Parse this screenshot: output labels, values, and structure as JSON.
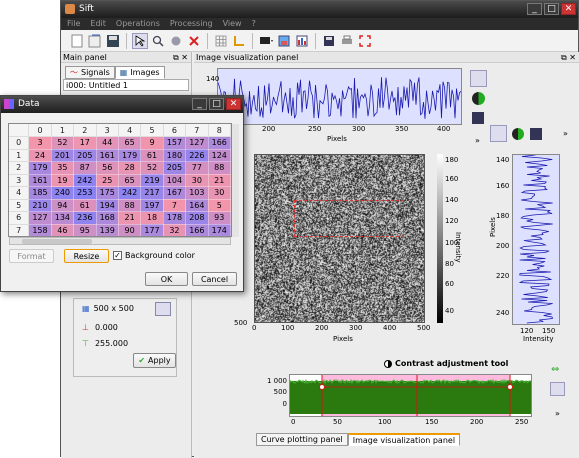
{
  "main": {
    "title": "Sift",
    "menu": [
      "File",
      "Edit",
      "Operations",
      "Processing",
      "View",
      "?"
    ]
  },
  "left_panel": {
    "title": "Main panel",
    "tabs": [
      "Signals",
      "Images"
    ],
    "item": "i000: Untitled 1",
    "size": "500 x 500",
    "min": "0.000",
    "max": "255.000",
    "apply": "Apply"
  },
  "image_panel": {
    "title": "Image visualization panel",
    "top_xlabel": "Pixels",
    "top_xticks": [
      "150",
      "200",
      "250",
      "300",
      "350",
      "400"
    ],
    "main_xlabel": "Pixels",
    "main_xticks": [
      "0",
      "100",
      "200",
      "300",
      "400",
      "500"
    ],
    "main_yticks": [
      "500"
    ],
    "colorbar_label": "Intensity",
    "colorbar_ticks": [
      "180",
      "160",
      "140",
      "120",
      "100",
      "80",
      "60",
      "40"
    ],
    "side_yticks": [
      "140",
      "160",
      "180",
      "200",
      "220",
      "240"
    ],
    "side_ylabel": "Pixels",
    "side_xticks": [
      "120",
      "150"
    ],
    "side_xlabel": "Intensity",
    "top_yticks": [
      "140"
    ],
    "contrast_title": "Contrast adjustment tool",
    "contrast_yticks": [
      "1 000",
      "500",
      "0"
    ],
    "contrast_xticks": [
      "0",
      "50",
      "100",
      "150",
      "200",
      "250"
    ],
    "bottom_tabs": [
      "Curve plotting panel",
      "Image visualization panel"
    ]
  },
  "dialog": {
    "title": "Data",
    "col_headers": [
      "0",
      "1",
      "2",
      "3",
      "4",
      "5",
      "6",
      "7",
      "8"
    ],
    "rows": [
      {
        "h": "0",
        "v": [
          "3",
          "52",
          "17",
          "44",
          "65",
          "9",
          "157",
          "127",
          "166"
        ]
      },
      {
        "h": "1",
        "v": [
          "24",
          "201",
          "205",
          "161",
          "179",
          "61",
          "180",
          "226",
          "124"
        ]
      },
      {
        "h": "2",
        "v": [
          "179",
          "35",
          "87",
          "56",
          "28",
          "52",
          "205",
          "77",
          "88"
        ]
      },
      {
        "h": "3",
        "v": [
          "161",
          "19",
          "242",
          "25",
          "65",
          "219",
          "104",
          "30",
          "21"
        ]
      },
      {
        "h": "4",
        "v": [
          "185",
          "240",
          "253",
          "175",
          "242",
          "217",
          "167",
          "103",
          "30"
        ]
      },
      {
        "h": "5",
        "v": [
          "210",
          "94",
          "61",
          "194",
          "88",
          "197",
          "7",
          "164",
          "5"
        ]
      },
      {
        "h": "6",
        "v": [
          "127",
          "134",
          "236",
          "168",
          "21",
          "18",
          "178",
          "208",
          "93"
        ]
      },
      {
        "h": "7",
        "v": [
          "158",
          "46",
          "95",
          "139",
          "90",
          "177",
          "32",
          "166",
          "174"
        ]
      }
    ],
    "format_btn": "Format",
    "resize_btn": "Resize",
    "bg_color_label": "Background color",
    "ok": "OK",
    "cancel": "Cancel"
  }
}
